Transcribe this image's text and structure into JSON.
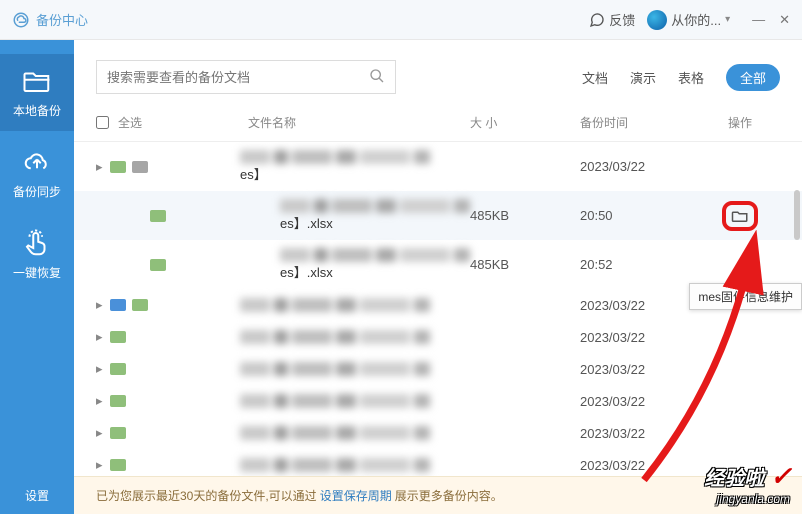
{
  "titlebar": {
    "app_name": "备份中心",
    "feedback": "反馈",
    "user": "从你的...",
    "min": "—",
    "close": "✕"
  },
  "sidebar": {
    "local_backup": "本地备份",
    "sync_backup": "备份同步",
    "one_click": "一键恢复",
    "settings": "设置"
  },
  "toolbar": {
    "search_placeholder": "搜索需要查看的备份文档",
    "filters": {
      "doc": "文档",
      "pres": "演示",
      "sheet": "表格",
      "all": "全部"
    }
  },
  "thead": {
    "select_all": "全选",
    "filename": "文件名称",
    "size": "大 小",
    "backup_time": "备份时间",
    "op": "操作"
  },
  "rows": [
    {
      "suffix": "es】",
      "size": "",
      "time": "2023/03/22",
      "ftype_colors": [
        "#8fbf7a",
        "#a6a6a6"
      ],
      "has_arrow": true
    },
    {
      "suffix": "es】.xlsx",
      "size": "485KB",
      "time": "20:50",
      "ftype_colors": [
        "#8fbf7a"
      ],
      "child": true,
      "hover": true,
      "show_open": true
    },
    {
      "suffix": "es】.xlsx",
      "size": "485KB",
      "time": "20:52",
      "ftype_colors": [
        "#8fbf7a"
      ],
      "child": true
    },
    {
      "suffix": "",
      "size": "",
      "time": "2023/03/22",
      "ftype_colors": [
        "#4a90d9",
        "#8fbf7a"
      ],
      "has_arrow": true
    },
    {
      "suffix": "",
      "size": "",
      "time": "2023/03/22",
      "ftype_colors": [
        "#8fbf7a"
      ],
      "has_arrow": true
    },
    {
      "suffix": "",
      "size": "",
      "time": "2023/03/22",
      "ftype_colors": [
        "#8fbf7a"
      ],
      "has_arrow": true
    },
    {
      "suffix": "",
      "size": "",
      "time": "2023/03/22",
      "ftype_colors": [
        "#8fbf7a"
      ],
      "has_arrow": true
    },
    {
      "suffix": "",
      "size": "",
      "time": "2023/03/22",
      "ftype_colors": [
        "#8fbf7a"
      ],
      "has_arrow": true
    },
    {
      "suffix": "",
      "size": "",
      "time": "2023/03/22",
      "ftype_colors": [
        "#8fbf7a"
      ],
      "has_arrow": true
    }
  ],
  "tooltip": "mes固件信息维护",
  "footer": {
    "pre": "已为您展示最近30天的备份文件,可以通过",
    "link": "设置保存周期",
    "post": "展示更多备份内容。"
  },
  "watermark": {
    "cn": "经验啦",
    "url": "jingyanla.com"
  }
}
